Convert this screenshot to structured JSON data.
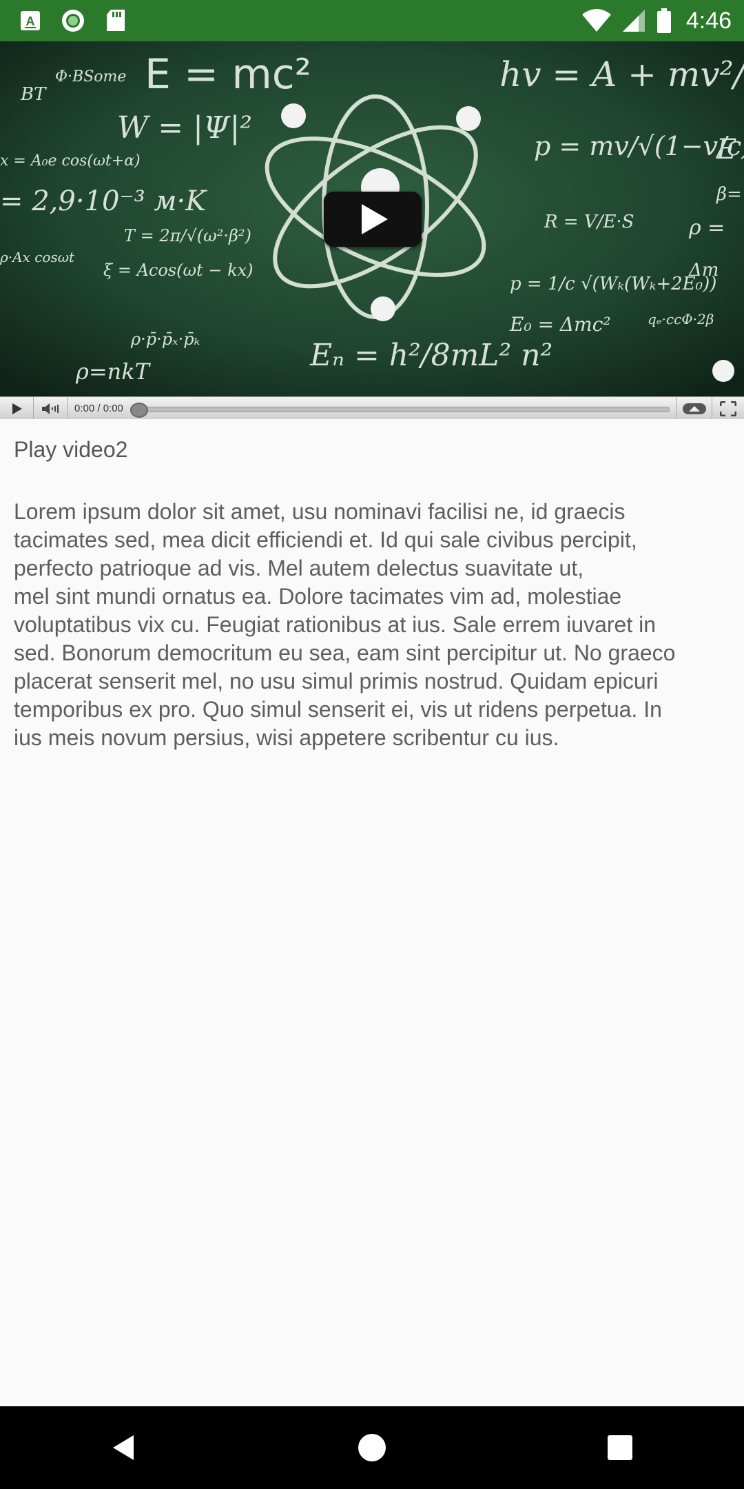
{
  "status_bar": {
    "time": "4:46",
    "left_icons": [
      "text-a-icon",
      "record-icon",
      "sd-card-icon"
    ],
    "right_icons": [
      "wifi-icon",
      "signal-icon",
      "battery-icon"
    ]
  },
  "video": {
    "time_display": "0:00 / 0:00",
    "progress": 0,
    "icons": {
      "play_overlay": "play-icon",
      "play": "play-icon",
      "volume": "volume-icon",
      "quality": "chevron-up-icon",
      "fullscreen": "fullscreen-icon"
    }
  },
  "content": {
    "title": "Play video2",
    "body": "Lorem ipsum dolor sit amet, usu nominavi facilisi ne, id graecis\ntacimates sed, mea dicit efficiendi et. Id qui sale civibus percipit,\nperfecto patrioque ad vis. Mel autem delectus suavitate ut,\nmel sint mundi ornatus ea. Dolore tacimates vim ad, molestiae\nvoluptatibus vix cu. Feugiat rationibus at ius. Sale errem iuvaret in\nsed. Bonorum democritum eu sea, eam sint percipitur ut. No graeco\nplacerat senserit mel, no usu simul primis nostrud. Quidam epicuri\ntemporibus ex pro. Quo simul senserit ei, vis ut ridens perpetua. In\nius meis novum persius, wisi appetere scribentur cu ius."
  },
  "nav": {
    "back": "back-icon",
    "home": "home-icon",
    "recents": "recents-icon"
  },
  "colors": {
    "status_bar": "#2b7a2b",
    "video_bg": "#1e3d2a",
    "page_bg": "#fafafa",
    "nav_bar": "#000000"
  }
}
